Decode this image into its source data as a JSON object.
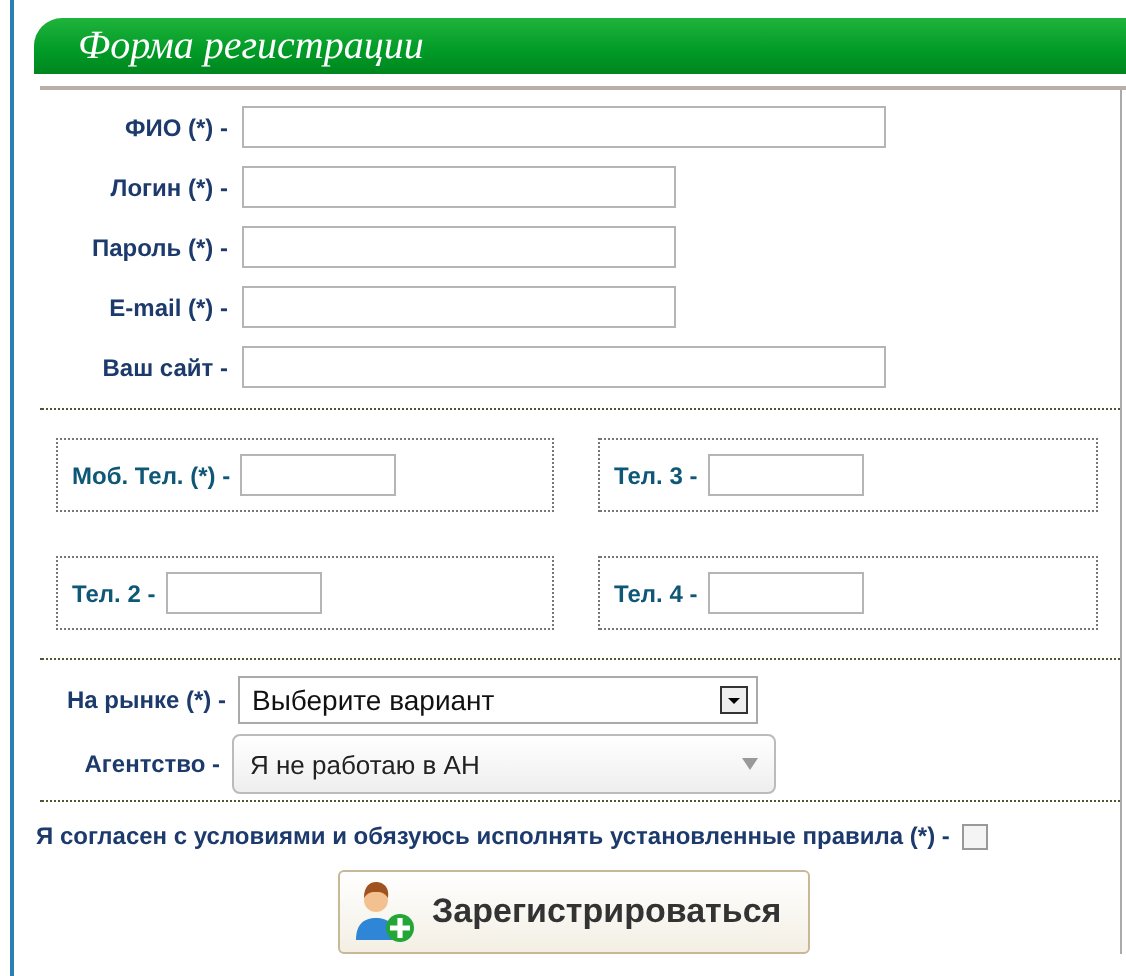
{
  "title": "Форма регистрации",
  "fields": [
    {
      "label": "ФИО (*) -",
      "kind": "long"
    },
    {
      "label": "Логин (*) -",
      "kind": "short"
    },
    {
      "label": "Пароль (*) -",
      "kind": "short"
    },
    {
      "label": "E-mail (*) -",
      "kind": "short"
    },
    {
      "label": "Ваш сайт -",
      "kind": "long"
    }
  ],
  "phones": [
    {
      "label": "Моб. Тел. (*) -"
    },
    {
      "label": "Тел. 3 -"
    },
    {
      "label": "Тел. 2 -"
    },
    {
      "label": "Тел. 4 -"
    }
  ],
  "selects": [
    {
      "label": "На рынке (*) -",
      "value": "Выберите вариант",
      "kind": "classic"
    },
    {
      "label": "Агентство -",
      "value": "Я не работаю в АН",
      "kind": "rounded"
    }
  ],
  "agreement": {
    "label": "Я согласен с условиями и обязуюсь исполнять установленные правила (*) -",
    "checked": false
  },
  "submit": "Зарегистрироваться"
}
